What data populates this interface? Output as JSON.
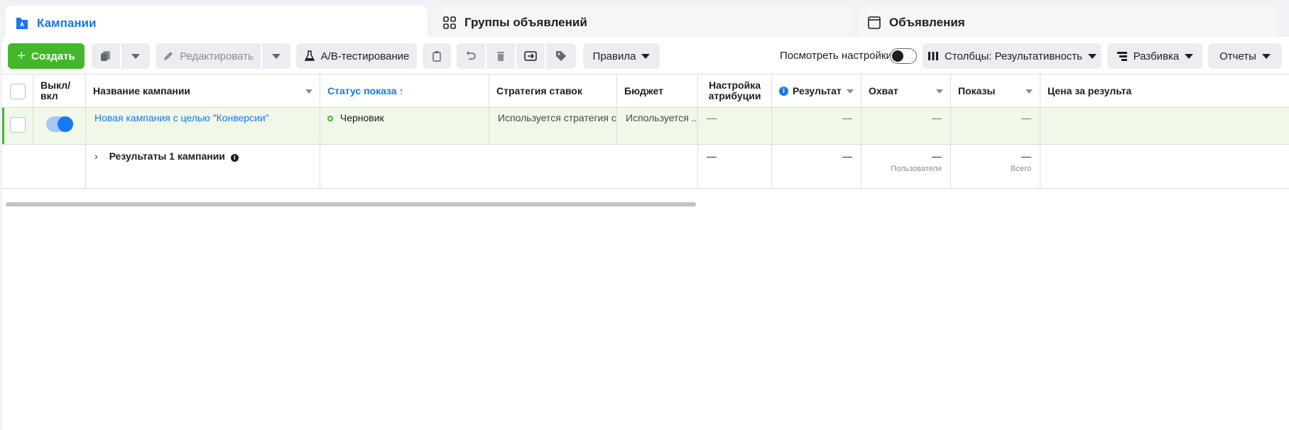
{
  "tabs": [
    {
      "label": "Кампании",
      "icon": "campaign-flag-icon",
      "active": true
    },
    {
      "label": "Группы объявлений",
      "icon": "adsets-grid-icon",
      "active": false
    },
    {
      "label": "Объявления",
      "icon": "ad-window-icon",
      "active": false
    }
  ],
  "toolbar": {
    "create_label": "Создать",
    "edit_label": "Редактировать",
    "ab_test_label": "A/B-тестирование",
    "rules_label": "Правила",
    "view_settings_label": "Посмотреть настройки",
    "columns_label": "Столбцы: Результативность",
    "breakdown_label": "Разбивка",
    "reports_label": "Отчеты"
  },
  "columns": {
    "toggle": "Выкл/\nвкл",
    "name": "Название кампании",
    "status": "Статус показа",
    "status_sort_arrow": "↑",
    "bid_strategy": "Стратегия ставок",
    "budget": "Бюджет",
    "attribution": "Настройка атрибуции",
    "result": "Результат",
    "reach": "Охват",
    "impressions": "Показы",
    "cost": "Цена за результа"
  },
  "rows": [
    {
      "name": "Новая кампания с целью \"Конверсии\"",
      "status": "Черновик",
      "bid_strategy": "Используется стратегия ст...",
      "budget": "Используется ...",
      "attribution": "—",
      "result": "—",
      "reach": "—",
      "impressions": "—"
    }
  ],
  "summary": {
    "label": "Результаты 1 кампании",
    "attribution": "—",
    "result": "—",
    "reach": "—",
    "reach_sub": "Пользователи",
    "impressions": "—",
    "impressions_sub": "Всего"
  },
  "colors": {
    "accent": "#1877f2",
    "create_green": "#42b72a",
    "row_highlight": "#f0f8ea",
    "draft_status": "#42b72a"
  }
}
